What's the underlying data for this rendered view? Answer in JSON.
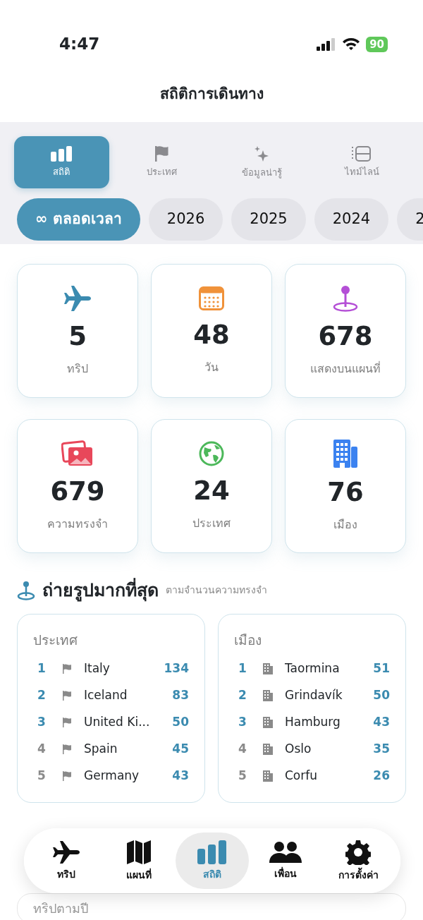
{
  "status_bar": {
    "time": "4:47",
    "battery": "90"
  },
  "title": "สถิติการเดินทาง",
  "segments": [
    {
      "label": "สถิติ",
      "selected": true
    },
    {
      "label": "ประเทศ",
      "selected": false
    },
    {
      "label": "ข้อมูลน่ารู้",
      "selected": false
    },
    {
      "label": "ไทม์ไลน์",
      "selected": false
    }
  ],
  "periods": [
    {
      "label": "∞ ตลอดเวลา",
      "selected": true
    },
    {
      "label": "2026",
      "selected": false
    },
    {
      "label": "2025",
      "selected": false
    },
    {
      "label": "2024",
      "selected": false
    },
    {
      "label": "2",
      "selected": false
    }
  ],
  "stats": [
    {
      "value": "5",
      "label": "ทริป",
      "color": "#3b8bb0"
    },
    {
      "value": "48",
      "label": "วัน",
      "color": "#f0923a"
    },
    {
      "value": "678",
      "label": "แสดงบนแผนที่",
      "color": "#b44fd6"
    },
    {
      "value": "679",
      "label": "ความทรงจำ",
      "color": "#e8475a"
    },
    {
      "value": "24",
      "label": "ประเทศ",
      "color": "#4cb85a"
    },
    {
      "value": "76",
      "label": "เมือง",
      "color": "#3b82f0"
    }
  ],
  "most_photographed": {
    "title": "ถ่ายรูปมากที่สุด",
    "subtitle": "ตามจำนวนความทรงจำ",
    "lists": [
      {
        "heading": "ประเทศ",
        "rows": [
          {
            "rank": "1",
            "name": "Italy",
            "count": "134",
            "highlighted": true
          },
          {
            "rank": "2",
            "name": "Iceland",
            "count": "83",
            "highlighted": true
          },
          {
            "rank": "3",
            "name": "United Ki...",
            "count": "50",
            "highlighted": true
          },
          {
            "rank": "4",
            "name": "Spain",
            "count": "45",
            "highlighted": false
          },
          {
            "rank": "5",
            "name": "Germany",
            "count": "43",
            "highlighted": false
          }
        ]
      },
      {
        "heading": "เมือง",
        "rows": [
          {
            "rank": "1",
            "name": "Taormina",
            "count": "51",
            "highlighted": true
          },
          {
            "rank": "2",
            "name": "Grindavík",
            "count": "50",
            "highlighted": true
          },
          {
            "rank": "3",
            "name": "Hamburg",
            "count": "43",
            "highlighted": true
          },
          {
            "rank": "4",
            "name": "Oslo",
            "count": "35",
            "highlighted": false
          },
          {
            "rank": "5",
            "name": "Corfu",
            "count": "26",
            "highlighted": false
          }
        ]
      }
    ]
  },
  "next_card": {
    "title": "ทริปตามปี"
  },
  "tab_bar": [
    {
      "label": "ทริป",
      "selected": false
    },
    {
      "label": "แผนที่",
      "selected": false
    },
    {
      "label": "สถิติ",
      "selected": true
    },
    {
      "label": "เพื่อน",
      "selected": false
    },
    {
      "label": "การตั้งค่า",
      "selected": false
    }
  ]
}
